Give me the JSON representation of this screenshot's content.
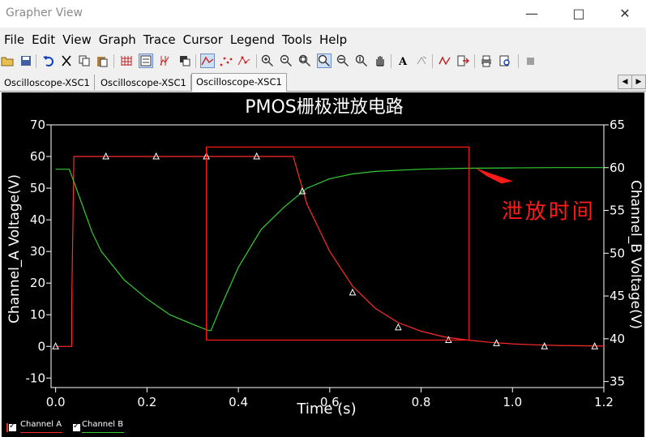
{
  "window": {
    "title": "Grapher View"
  },
  "menu": [
    "File",
    "Edit",
    "View",
    "Graph",
    "Trace",
    "Cursor",
    "Legend",
    "Tools",
    "Help"
  ],
  "tabs": [
    "Oscilloscope-XSC1",
    "Oscilloscope-XSC1",
    "Oscilloscope-XSC1"
  ],
  "toolbar_icons": [
    "open-icon",
    "save-icon",
    "undo-icon",
    "cut-icon",
    "copy-icon",
    "paste-icon",
    "grid-icon",
    "legend-icon",
    "cursor-icon",
    "overlay-icon",
    "line-icon",
    "dots-icon",
    "markers-icon",
    "zoom-in-icon",
    "zoom-out-icon",
    "zoom-fit-icon",
    "zoom-area-icon",
    "zoom-x-icon",
    "zoom-y-icon",
    "pan-icon",
    "text-icon",
    "rotate-text-icon",
    "trace-props-icon",
    "export-icon",
    "print-icon",
    "print-preview-icon",
    "stop-icon"
  ],
  "colors": {
    "channel_a": "#ff2a2a",
    "channel_b": "#33cc33",
    "annotation": "#ff1a1a",
    "plot_bg": "#000000"
  },
  "chart_data": {
    "type": "line",
    "title": "PMOS栅极泄放电路",
    "xlabel": "Time (s)",
    "ylabel": "Channel_A Voltage(V)",
    "ylabel_right": "Channel_B Voltage(V)",
    "xlim": [
      -0.01,
      1.2
    ],
    "ylim": [
      -13,
      70
    ],
    "ylim_right": [
      34.3,
      65
    ],
    "x_ticks": [
      "0.0",
      "0.2",
      "0.4",
      "0.6",
      "0.8",
      "1.0",
      "1.2"
    ],
    "y_ticks": [
      "-10",
      "0",
      "10",
      "20",
      "30",
      "40",
      "50",
      "60",
      "70"
    ],
    "y_ticks_right": [
      "35",
      "40",
      "45",
      "50",
      "55",
      "60",
      "65"
    ],
    "grid": false,
    "legend": "bottom-left",
    "series": [
      {
        "name": "Channel A",
        "color": "#ff2a2a",
        "x": [
          0,
          0.035,
          0.035,
          0.04,
          0.045,
          0.1,
          0.2,
          0.3,
          0.4,
          0.5,
          0.52,
          0.55,
          0.6,
          0.65,
          0.7,
          0.75,
          0.8,
          0.85,
          0.9,
          0.95,
          1.0,
          1.05,
          1.1,
          1.15,
          1.2
        ],
        "y": [
          0,
          0,
          12,
          60,
          60,
          60,
          60,
          60,
          60,
          60,
          60,
          45,
          30,
          19,
          12,
          7.5,
          4.8,
          3.0,
          2.0,
          1.3,
          0.8,
          0.5,
          0.3,
          0.2,
          0.1
        ]
      },
      {
        "name": "Channel B",
        "color": "#33cc33",
        "x": [
          0,
          0.03,
          0.04,
          0.06,
          0.08,
          0.1,
          0.15,
          0.2,
          0.25,
          0.3,
          0.335,
          0.34,
          0.36,
          0.4,
          0.45,
          0.5,
          0.55,
          0.6,
          0.65,
          0.7,
          0.8,
          0.9,
          1.0,
          1.1,
          1.2
        ],
        "y": [
          56,
          56,
          52,
          44,
          36,
          30,
          21,
          15,
          10,
          7,
          5,
          5,
          12,
          25,
          37,
          44,
          50,
          53,
          54.5,
          55.3,
          56,
          56.3,
          56.4,
          56.5,
          56.5
        ]
      }
    ],
    "markers": {
      "x": [
        0,
        0.11,
        0.22,
        0.33,
        0.44,
        0.54,
        0.65,
        0.75,
        0.86,
        0.965,
        1.07,
        1.18
      ],
      "y": [
        0,
        60,
        60,
        60,
        60,
        49,
        17,
        6,
        2,
        1,
        0,
        0
      ]
    },
    "annotation": {
      "text": "泄放时间",
      "x_range": [
        0.33,
        0.905
      ],
      "y_range": [
        2,
        63
      ]
    }
  },
  "legend_items": [
    {
      "label": "Channel A",
      "color": "#ff2a2a"
    },
    {
      "label": "Channel B",
      "color": "#33cc33"
    }
  ]
}
